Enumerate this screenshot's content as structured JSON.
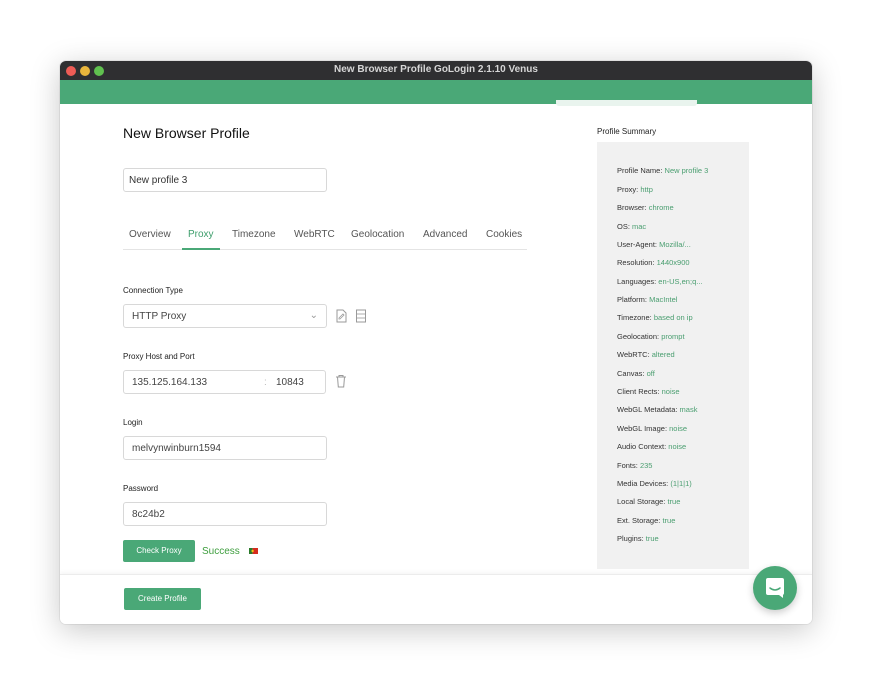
{
  "window": {
    "title": "New Browser Profile GoLogin 2.1.10 Venus"
  },
  "page": {
    "title": "New Browser Profile",
    "profile_name": "New profile 3"
  },
  "tabs": [
    "Overview",
    "Proxy",
    "Timezone",
    "WebRTC",
    "Geolocation",
    "Advanced",
    "Cookies"
  ],
  "proxy": {
    "connection_type_label": "Connection Type",
    "connection_type_value": "HTTP Proxy",
    "host_port_label": "Proxy Host and Port",
    "host": "135.125.164.133",
    "separator": ":",
    "port": "10843",
    "login_label": "Login",
    "login": "melvynwinburn1594",
    "password_label": "Password",
    "password": "8c24b2",
    "check_button": "Check Proxy",
    "status": "Success"
  },
  "summary": {
    "title": "Profile Summary",
    "rows": [
      {
        "key": "Profile Name:",
        "value": "New profile 3"
      },
      {
        "key": "Proxy:",
        "value": "http"
      },
      {
        "key": "Browser:",
        "value": "chrome"
      },
      {
        "key": "OS:",
        "value": "mac"
      },
      {
        "key": "User-Agent:",
        "value": "Mozilla/..."
      },
      {
        "key": "Resolution:",
        "value": "1440x900"
      },
      {
        "key": "Languages:",
        "value": "en-US,en;q..."
      },
      {
        "key": "Platform:",
        "value": "MacIntel"
      },
      {
        "key": "Timezone:",
        "value": "based on ip"
      },
      {
        "key": "Geolocation:",
        "value": "prompt"
      },
      {
        "key": "WebRTC:",
        "value": "altered"
      },
      {
        "key": "Canvas:",
        "value": "off"
      },
      {
        "key": "Client Rects:",
        "value": "noise"
      },
      {
        "key": "WebGL Metadata:",
        "value": "mask"
      },
      {
        "key": "WebGL Image:",
        "value": "noise"
      },
      {
        "key": "Audio Context:",
        "value": "noise"
      },
      {
        "key": "Fonts:",
        "value": "235"
      },
      {
        "key": "Media Devices:",
        "value": "(1|1|1)"
      },
      {
        "key": "Local Storage:",
        "value": "true"
      },
      {
        "key": "Ext. Storage:",
        "value": "true"
      },
      {
        "key": "Plugins:",
        "value": "true"
      }
    ]
  },
  "footer": {
    "create_button": "Create Profile"
  },
  "colors": {
    "accent": "#4aa877",
    "titlebar": "#2f2f31",
    "summary_bg": "#f1f1f1"
  }
}
